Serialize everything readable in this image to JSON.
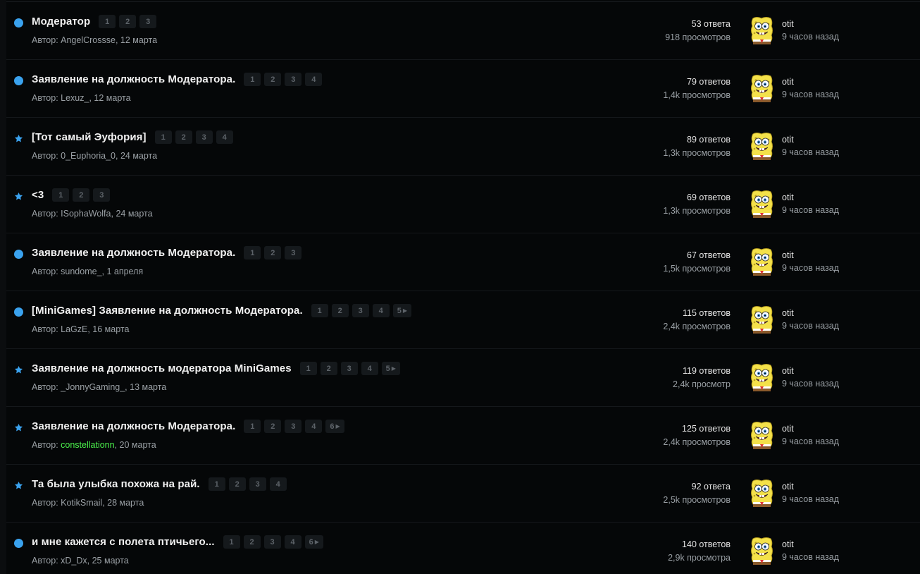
{
  "colors": {
    "background": "#050708",
    "unread_dot": "#3aa2ee",
    "star": "#3aa2ee",
    "title": "#f1f1f1",
    "muted": "#9aa0a5",
    "highlight_author": "#4cf24c",
    "page_chip_bg": "#15191c"
  },
  "threads": [
    {
      "marker": "dot",
      "title": "Модератор",
      "pages": [
        "1",
        "2",
        "3"
      ],
      "author_prefix": "Автор: ",
      "author": "AngelCrossse",
      "date": ", 12 марта",
      "replies": "53 ответа",
      "views": "918 просмотров",
      "last_user": "otit",
      "last_time": "9 часов назад",
      "avatar_icon": "spongebob-avatar"
    },
    {
      "marker": "dot",
      "title": "Заявление на должность Модератора.",
      "pages": [
        "1",
        "2",
        "3",
        "4"
      ],
      "author_prefix": "Автор: ",
      "author": "Lexuz_",
      "date": ", 12 марта",
      "replies": "79 ответов",
      "views": "1,4k просмотров",
      "last_user": "otit",
      "last_time": "9 часов назад",
      "avatar_icon": "spongebob-avatar"
    },
    {
      "marker": "star",
      "title": "[Тот самый Эуфория]",
      "pages": [
        "1",
        "2",
        "3",
        "4"
      ],
      "author_prefix": "Автор: ",
      "author": "0_Euphoria_0",
      "date": ", 24 марта",
      "replies": "89 ответов",
      "views": "1,3k просмотров",
      "last_user": "otit",
      "last_time": "9 часов назад",
      "avatar_icon": "spongebob-avatar"
    },
    {
      "marker": "star",
      "title": "<3",
      "pages": [
        "1",
        "2",
        "3"
      ],
      "author_prefix": "Автор: ",
      "author": "ISophaWolfa",
      "date": ", 24 марта",
      "replies": "69 ответов",
      "views": "1,3k просмотров",
      "last_user": "otit",
      "last_time": "9 часов назад",
      "avatar_icon": "spongebob-avatar"
    },
    {
      "marker": "dot",
      "title": "Заявление на должность Модератора.",
      "pages": [
        "1",
        "2",
        "3"
      ],
      "author_prefix": "Автор: ",
      "author": "sundome_",
      "date": ", 1 апреля",
      "replies": "67 ответов",
      "views": "1,5k просмотров",
      "last_user": "otit",
      "last_time": "9 часов назад",
      "avatar_icon": "spongebob-avatar"
    },
    {
      "marker": "dot",
      "title": "[MiniGames] Заявление на должность Модератора.",
      "pages": [
        "1",
        "2",
        "3",
        "4",
        "5"
      ],
      "last_page_arrow": true,
      "author_prefix": "Автор: ",
      "author": "LaGzE",
      "date": ", 16 марта",
      "replies": "115 ответов",
      "views": "2,4k просмотров",
      "last_user": "otit",
      "last_time": "9 часов назад",
      "avatar_icon": "spongebob-avatar"
    },
    {
      "marker": "star",
      "title": "Заявление на должность модератора MiniGames",
      "pages": [
        "1",
        "2",
        "3",
        "4",
        "5"
      ],
      "last_page_arrow": true,
      "author_prefix": "Автор: ",
      "author": "_JonnyGaming_",
      "date": ", 13 марта",
      "replies": "119 ответов",
      "views": "2,4k просмотр",
      "last_user": "otit",
      "last_time": "9 часов назад",
      "avatar_icon": "spongebob-avatar"
    },
    {
      "marker": "star",
      "title": "Заявление на должность Модератора.",
      "pages": [
        "1",
        "2",
        "3",
        "4",
        "6"
      ],
      "last_page_arrow": true,
      "author_prefix": "Автор: ",
      "author": "constellationn",
      "author_green": true,
      "date": ", 20 марта",
      "replies": "125 ответов",
      "views": "2,4k просмотров",
      "last_user": "otit",
      "last_time": "9 часов назад",
      "avatar_icon": "spongebob-avatar"
    },
    {
      "marker": "star",
      "title": "Та была улыбка похожа на рай.",
      "pages": [
        "1",
        "2",
        "3",
        "4"
      ],
      "author_prefix": "Автор: ",
      "author": "KotikSmail",
      "date": ", 28 марта",
      "replies": "92 ответа",
      "views": "2,5k просмотров",
      "last_user": "otit",
      "last_time": "9 часов назад",
      "avatar_icon": "spongebob-avatar"
    },
    {
      "marker": "dot",
      "title": "и мне кажется с полета птичьего...",
      "pages": [
        "1",
        "2",
        "3",
        "4",
        "6"
      ],
      "last_page_arrow": true,
      "author_prefix": "Автор: ",
      "author": "xD_Dx",
      "date": ", 25 марта",
      "replies": "140 ответов",
      "views": "2,9k просмотра",
      "last_user": "otit",
      "last_time": "9 часов назад",
      "avatar_icon": "spongebob-avatar"
    }
  ]
}
